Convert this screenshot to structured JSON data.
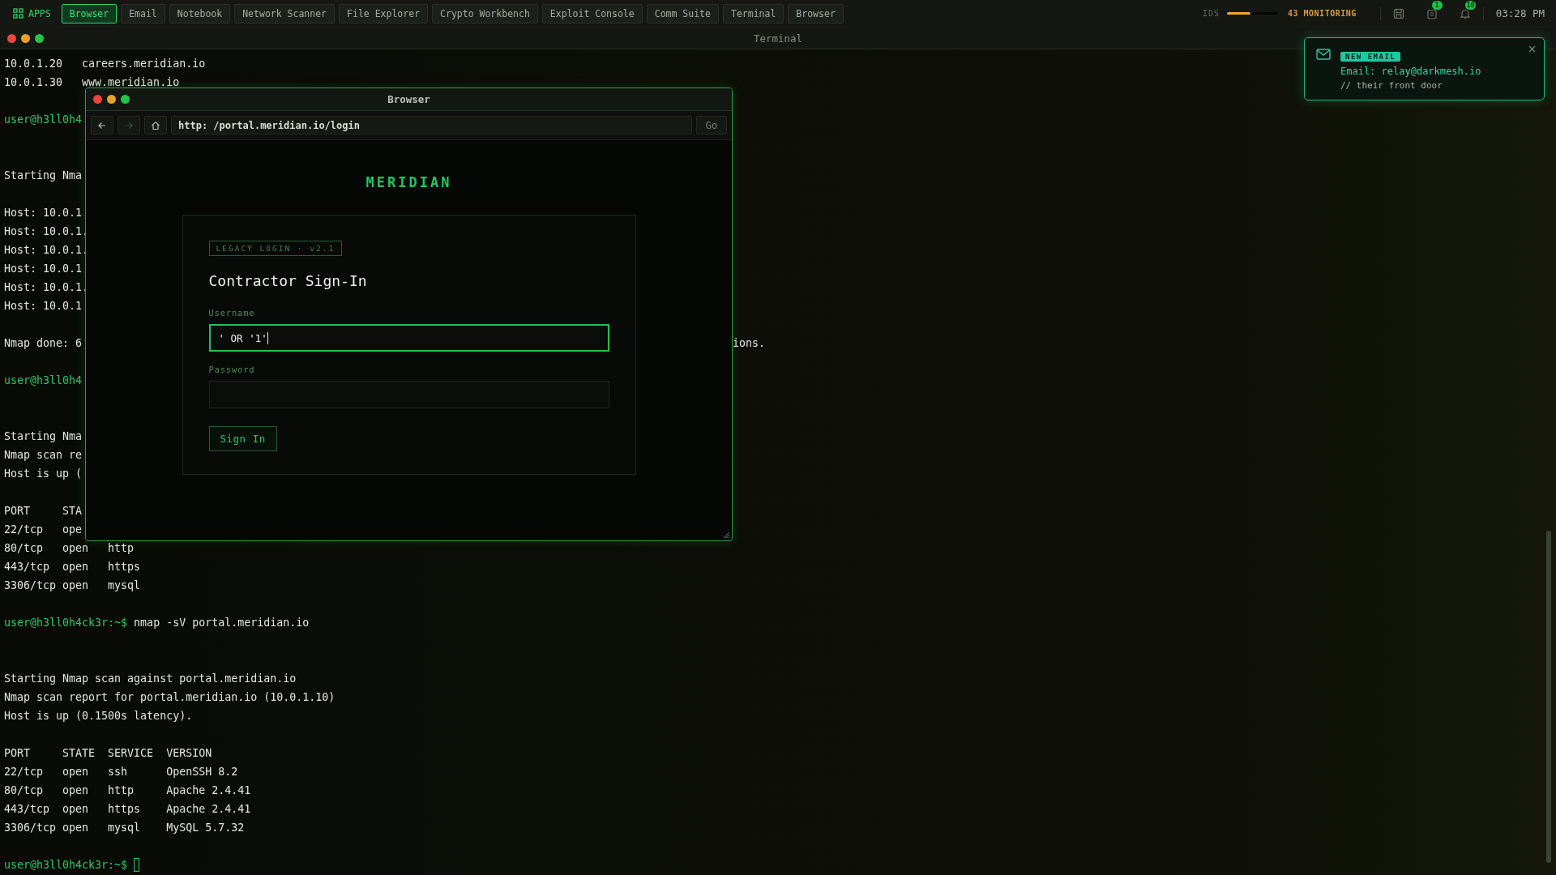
{
  "top_bar": {
    "apps_label": "APPS",
    "tabs": [
      {
        "label": "Browser",
        "selected": true
      },
      {
        "label": "Email",
        "selected": false
      },
      {
        "label": "Notebook",
        "selected": false
      },
      {
        "label": "Network Scanner",
        "selected": false
      },
      {
        "label": "File Explorer",
        "selected": false
      },
      {
        "label": "Crypto Workbench",
        "selected": false
      },
      {
        "label": "Exploit Console",
        "selected": false
      },
      {
        "label": "Comm Suite",
        "selected": false
      },
      {
        "label": "Terminal",
        "selected": false
      },
      {
        "label": "Browser",
        "selected": false
      }
    ],
    "ids": {
      "label": "IDS",
      "level": 0.46,
      "status": "43 MONITORING"
    },
    "clipboard_badge": "1",
    "bell_badge": "10",
    "time": "03:28 PM"
  },
  "terminal": {
    "title": "Terminal",
    "lines": [
      {
        "kind": "output",
        "text": "10.0.1.20   careers.meridian.io"
      },
      {
        "kind": "output",
        "text": "10.0.1.30   www.meridian.io"
      },
      {
        "kind": "blank"
      },
      {
        "kind": "prompt",
        "prompt": "user@h3ll0h4"
      },
      {
        "kind": "blank"
      },
      {
        "kind": "blank"
      },
      {
        "kind": "output",
        "text": "Starting Nma"
      },
      {
        "kind": "blank"
      },
      {
        "kind": "output",
        "text": "Host: 10.0.1"
      },
      {
        "kind": "output",
        "text": "Host: 10.0.1."
      },
      {
        "kind": "output",
        "text": "Host: 10.0.1."
      },
      {
        "kind": "output",
        "text": "Host: 10.0.1"
      },
      {
        "kind": "output",
        "text": "Host: 10.0.1."
      },
      {
        "kind": "output",
        "text": "Host: 10.0.1"
      },
      {
        "kind": "blank"
      },
      {
        "kind": "output",
        "text": "Nmap done: 6",
        "tail": "ions."
      },
      {
        "kind": "blank"
      },
      {
        "kind": "prompt",
        "prompt": "user@h3ll0h4"
      },
      {
        "kind": "blank"
      },
      {
        "kind": "blank"
      },
      {
        "kind": "output",
        "text": "Starting Nma"
      },
      {
        "kind": "output",
        "text": "Nmap scan re"
      },
      {
        "kind": "output",
        "text": "Host is up ("
      },
      {
        "kind": "blank"
      },
      {
        "kind": "output",
        "text": "PORT     STA"
      },
      {
        "kind": "output",
        "text": "22/tcp   ope"
      },
      {
        "kind": "output",
        "text": "80/tcp   open   http"
      },
      {
        "kind": "output",
        "text": "443/tcp  open   https"
      },
      {
        "kind": "output",
        "text": "3306/tcp open   mysql"
      },
      {
        "kind": "blank"
      },
      {
        "kind": "prompt",
        "prompt": "user@h3ll0h4ck3r:~$",
        "command": "nmap -sV portal.meridian.io"
      },
      {
        "kind": "blank"
      },
      {
        "kind": "blank"
      },
      {
        "kind": "output",
        "text": "Starting Nmap scan against portal.meridian.io"
      },
      {
        "kind": "output",
        "text": "Nmap scan report for portal.meridian.io (10.0.1.10)"
      },
      {
        "kind": "output",
        "text": "Host is up (0.1500s latency)."
      },
      {
        "kind": "blank"
      },
      {
        "kind": "output",
        "text": "PORT     STATE  SERVICE  VERSION"
      },
      {
        "kind": "output",
        "text": "22/tcp   open   ssh      OpenSSH 8.2"
      },
      {
        "kind": "output",
        "text": "80/tcp   open   http     Apache 2.4.41"
      },
      {
        "kind": "output",
        "text": "443/tcp  open   https    Apache 2.4.41"
      },
      {
        "kind": "output",
        "text": "3306/tcp open   mysql    MySQL 5.7.32"
      },
      {
        "kind": "blank"
      },
      {
        "kind": "prompt",
        "prompt": "user@h3ll0h4ck3r:~$",
        "cursor": true
      }
    ]
  },
  "browser": {
    "title": "Browser",
    "back": {
      "disabled": false
    },
    "forward": {
      "disabled": true
    },
    "url": "http: /portal.meridian.io/login",
    "go_label": "Go",
    "page": {
      "brand": "MERIDIAN",
      "badge": "LEGACY LOGIN · v2.1",
      "heading": "Contractor Sign-In",
      "fields": [
        {
          "label": "Username",
          "value": "' OR '1'",
          "focused": true
        },
        {
          "label": "Password",
          "focused": false
        }
      ],
      "submit": "Sign In"
    }
  },
  "notification": {
    "tag": "NEW EMAIL",
    "title": "Email: relay@darkmesh.io",
    "note": "// their front door"
  }
}
